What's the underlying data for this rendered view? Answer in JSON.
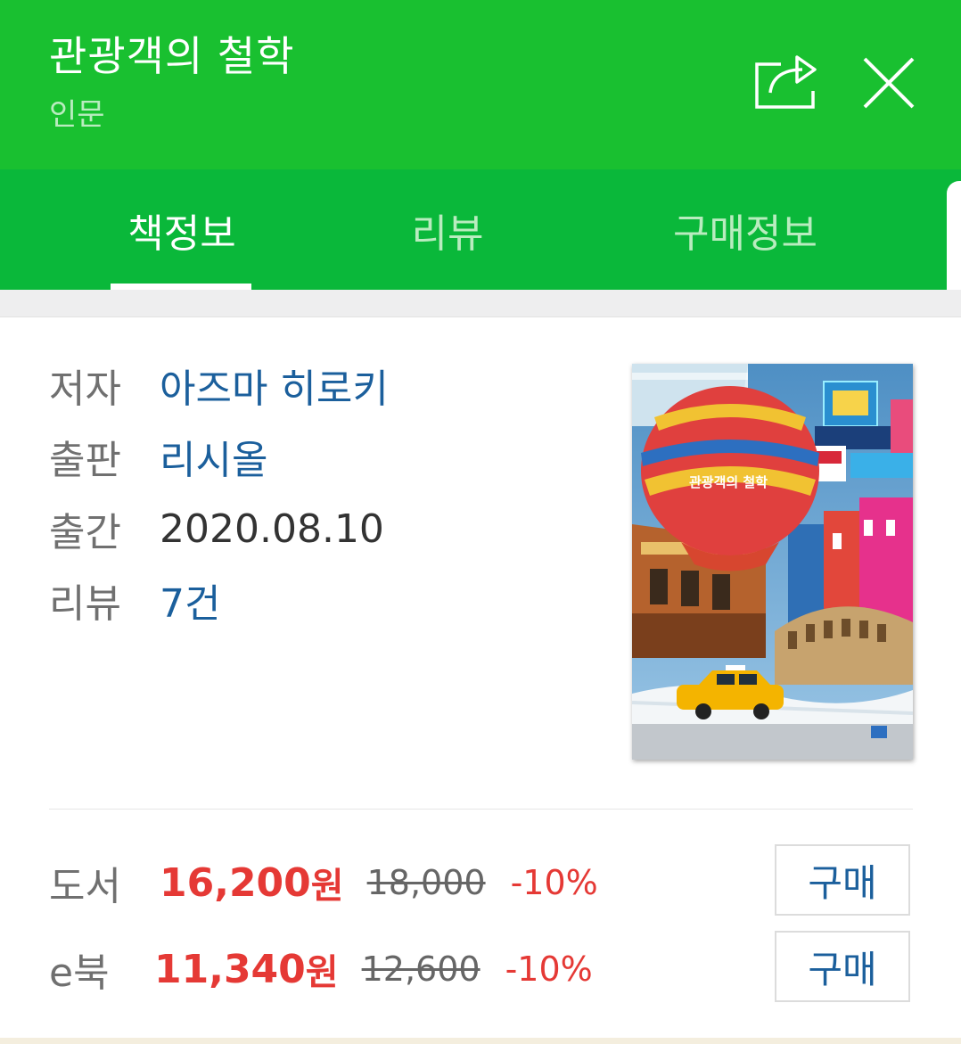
{
  "header": {
    "title": "관광객의 철학",
    "subtitle": "인문"
  },
  "icons": {
    "share": "share-icon",
    "close": "close-icon"
  },
  "tabs": [
    {
      "label": "책정보",
      "active": true
    },
    {
      "label": "리뷰",
      "active": false
    },
    {
      "label": "구매정보",
      "active": false
    }
  ],
  "info": {
    "author_label": "저자",
    "author_value": "아즈마 히로키",
    "publisher_label": "출판",
    "publisher_value": "리시올",
    "date_label": "출간",
    "date_value": "2020.08.10",
    "review_label": "리뷰",
    "review_value": "7건"
  },
  "cover": {
    "balloon_text": "관광객의 철학"
  },
  "prices": [
    {
      "label": "도서",
      "sale": "16,200",
      "unit": "원",
      "original": "18,000",
      "discount": "-10%",
      "button": "구매"
    },
    {
      "label": "e북",
      "sale": "11,340",
      "unit": "원",
      "original": "12,600",
      "discount": "-10%",
      "button": "구매"
    }
  ],
  "colors": {
    "header_green": "#19c030",
    "tab_green": "#0ab83a",
    "link_blue": "#1b5f9c",
    "price_red": "#e53935"
  }
}
